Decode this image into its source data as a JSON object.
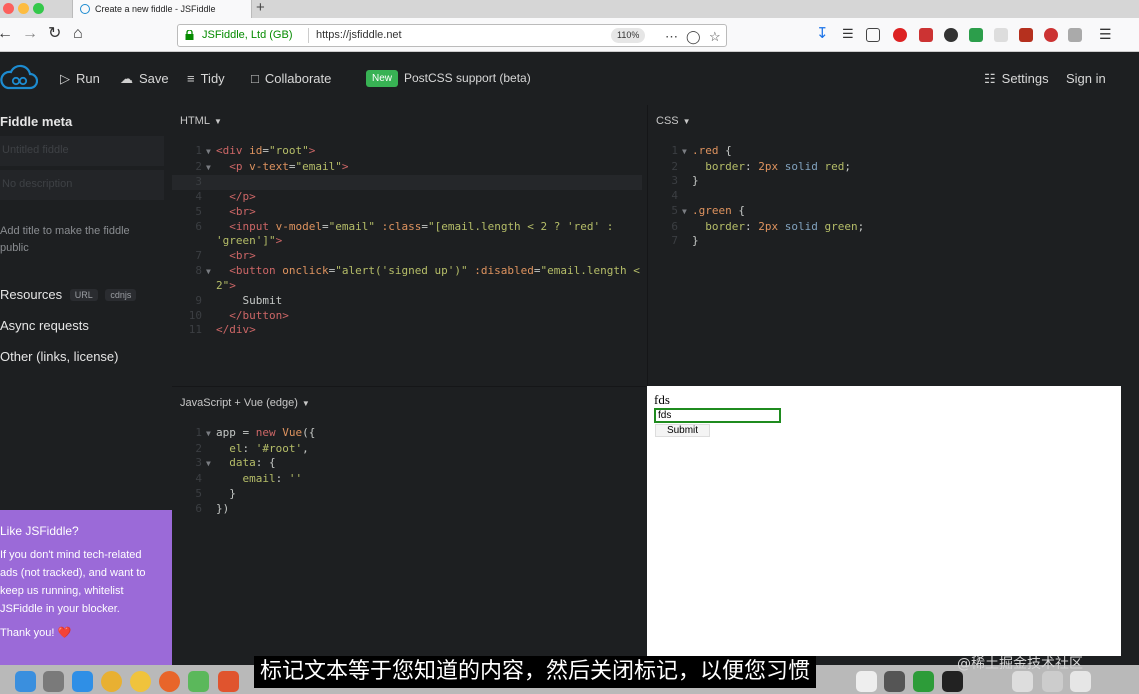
{
  "browser": {
    "tab_title": "Create a new fiddle - JSFiddle",
    "new_tab_glyph": "+",
    "site_identity": "JSFiddle, Ltd (GB)",
    "url": "https://jsfiddle.net",
    "zoom": "110%"
  },
  "header": {
    "run_label": "Run",
    "save_label": "Save",
    "tidy_label": "Tidy",
    "collaborate_label": "Collaborate",
    "new_badge": "New",
    "announcement": "PostCSS support (beta)",
    "settings_label": "Settings",
    "signin_label": "Sign in"
  },
  "sidebar": {
    "title": "Fiddle meta",
    "title_placeholder": "Untitled fiddle",
    "description_placeholder": "No description",
    "note": "Add title to make the fiddle public",
    "resources_label": "Resources",
    "resources_pill_url": "URL",
    "resources_pill_cdnjs": "cdnjs",
    "async_label": "Async requests",
    "other_label": "Other (links, license)",
    "ad": {
      "heading": "Like JSFiddle?",
      "body": "If you don't mind tech-related ads (not tracked), and want to keep us running, whitelist JSFiddle in your blocker.",
      "thanks": "Thank you! ❤️"
    }
  },
  "panels": {
    "html_label": "HTML",
    "css_label": "CSS",
    "js_label": "JavaScript + Vue (edge)"
  },
  "result": {
    "text": "fds",
    "input_value": "fds",
    "button_label": "Submit"
  },
  "overlay": {
    "subtitle": "标记文本等于您知道的内容，然后关闭标记，以便您习惯",
    "watermark": "@稀土掘金技术社区"
  },
  "colors": {
    "accent_green": "#38b254",
    "ad_purple": "#9b6ad8",
    "editor_bg": "#1d1f21"
  }
}
